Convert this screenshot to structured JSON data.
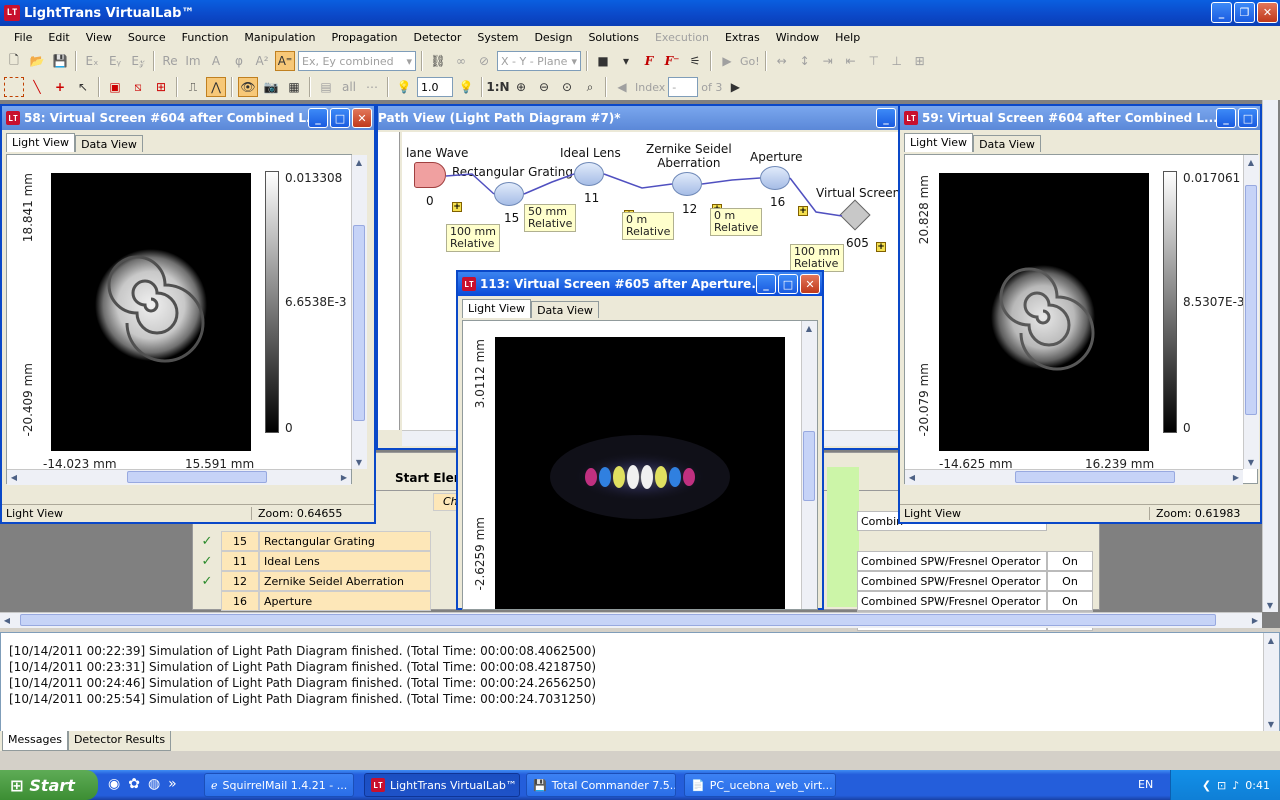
{
  "app": {
    "title": "LightTrans VirtualLab™",
    "icon_text": "LT"
  },
  "menu": [
    "File",
    "Edit",
    "View",
    "Source",
    "Function",
    "Manipulation",
    "Propagation",
    "Detector",
    "System",
    "Design",
    "Solutions",
    "Execution",
    "Extras",
    "Window",
    "Help"
  ],
  "menu_disabled": [
    "Execution"
  ],
  "toolbar1": {
    "field_combo": "Ex, Ey combined",
    "plane_combo": "X - Y - Plane",
    "go_label": "Go!"
  },
  "toolbar2": {
    "zoom_value": "1.0",
    "index_label": "Index",
    "index_value": "-",
    "of_label": "of 3"
  },
  "win58": {
    "title": "58: Virtual Screen #604 after Combined L...",
    "tabs": [
      "Light View",
      "Data View"
    ],
    "y_top": "18.841 mm",
    "y_bottom": "-20.409 mm",
    "x_left": "-14.023 mm",
    "x_right": "15.591 mm",
    "cbar_max": "0.013308",
    "cbar_mid": "6.6538E-3",
    "cbar_min": "0",
    "status_left": "Light View",
    "status_zoom": "Zoom: 0.64655"
  },
  "win59": {
    "title": "59: Virtual Screen #604 after Combined L...",
    "tabs": [
      "Light View",
      "Data View"
    ],
    "y_top": "20.828 mm",
    "y_bottom": "-20.079 mm",
    "x_left": "-14.625 mm",
    "x_right": "16.239 mm",
    "cbar_max": "0.017061",
    "cbar_mid": "8.5307E-3",
    "cbar_min": "0",
    "status_left": "Light View",
    "status_zoom": "Zoom: 0.61983"
  },
  "win113": {
    "title": "113: Virtual Screen #605 after Aperture...",
    "tabs": [
      "Light View",
      "Data View"
    ],
    "y_top": "3.0112 mm",
    "y_bottom": "-2.6259 mm"
  },
  "diagram": {
    "title": "Path View (Light Path Diagram #7)*",
    "elements": [
      {
        "name": "lane Wave",
        "id": "0"
      },
      {
        "name": "Rectangular Grating",
        "id": "15"
      },
      {
        "name": "Ideal Lens",
        "id": "11"
      },
      {
        "name": "Zernike Seidel\nAberration",
        "id": "12"
      },
      {
        "name": "Aperture",
        "id": "16"
      },
      {
        "name": "Virtual Screen",
        "id": "605"
      }
    ],
    "notes": [
      "100 mm\nRelative",
      "50 mm\nRelative",
      "0 m\nRelative",
      "0 m\nRelative",
      "100 mm\nRelative"
    ]
  },
  "table": {
    "header_start": "Start Eleme",
    "header_sub": "Ch",
    "rows": [
      {
        "check": "✓",
        "id": "15",
        "name": "Rectangular Grating",
        "operator": "Combined SPW/Fresnel Operator",
        "state": "On"
      },
      {
        "check": "✓",
        "id": "11",
        "name": "Ideal Lens",
        "operator": "Combined SPW/Fresnel Operator",
        "state": "On"
      },
      {
        "check": "✓",
        "id": "12",
        "name": "Zernike Seidel Aberration",
        "operator": "Combined SPW/Fresnel Operator",
        "state": "On"
      },
      {
        "check": "",
        "id": "16",
        "name": "Aperture",
        "operator": "",
        "state": ""
      }
    ],
    "partial_operator": "Combin"
  },
  "messages": [
    "[10/14/2011 00:22:39] Simulation of Light Path Diagram finished. (Total Time: 00:00:08.4062500)",
    "[10/14/2011 00:23:31] Simulation of Light Path Diagram finished. (Total Time: 00:00:08.4218750)",
    "[10/14/2011 00:24:46] Simulation of Light Path Diagram finished. (Total Time: 00:00:24.2656250)",
    "[10/14/2011 00:25:54] Simulation of Light Path Diagram finished. (Total Time: 00:00:24.7031250)"
  ],
  "bottom_tabs": [
    "Messages",
    "Detector Results"
  ],
  "taskbar": {
    "start": "Start",
    "tasks": [
      "SquirrelMail 1.4.21 - ...",
      "LightTrans VirtualLab™",
      "Total Commander 7.5...",
      "PC_ucebna_web_virt..."
    ],
    "lang": "EN",
    "clock": "0:41"
  },
  "colors": {
    "title_blue": "#0a48c8",
    "xp_face": "#ece9d8",
    "taskbar_blue": "#245edb",
    "start_green": "#3c8e33"
  }
}
